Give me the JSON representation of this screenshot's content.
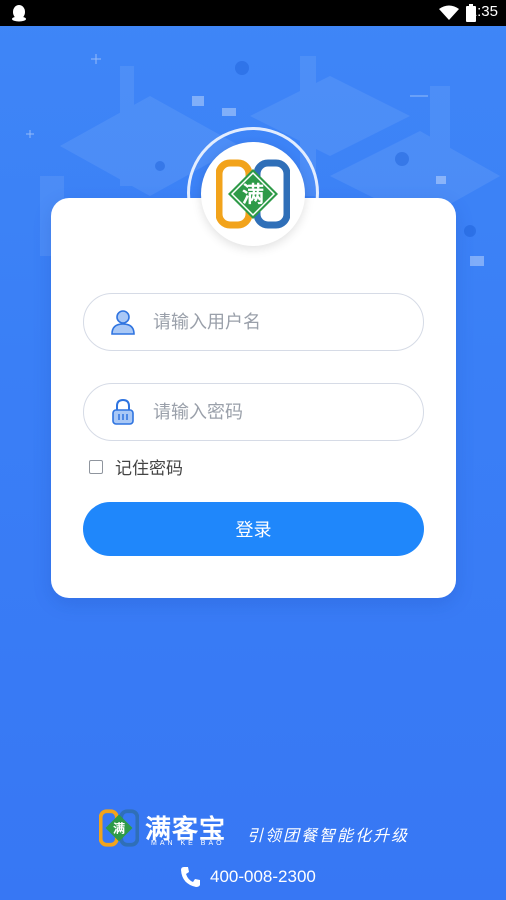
{
  "status_bar": {
    "time": "1:35"
  },
  "login": {
    "username_placeholder": "请输入用户名",
    "password_placeholder": "请输入密码",
    "remember_label": "记住密码",
    "login_button": "登录"
  },
  "logo": {
    "mark": "满"
  },
  "footer": {
    "brand_name": "满客宝",
    "brand_pinyin": "MAN KE BAO",
    "slogan": "引领团餐智能化升级",
    "phone": "400-008-2300"
  },
  "colors": {
    "background": "#3a7ff6",
    "button": "#1f87fb",
    "logo_orange": "#f2a31b",
    "logo_blue": "#2f6fb8",
    "logo_green": "#2e9a48"
  }
}
